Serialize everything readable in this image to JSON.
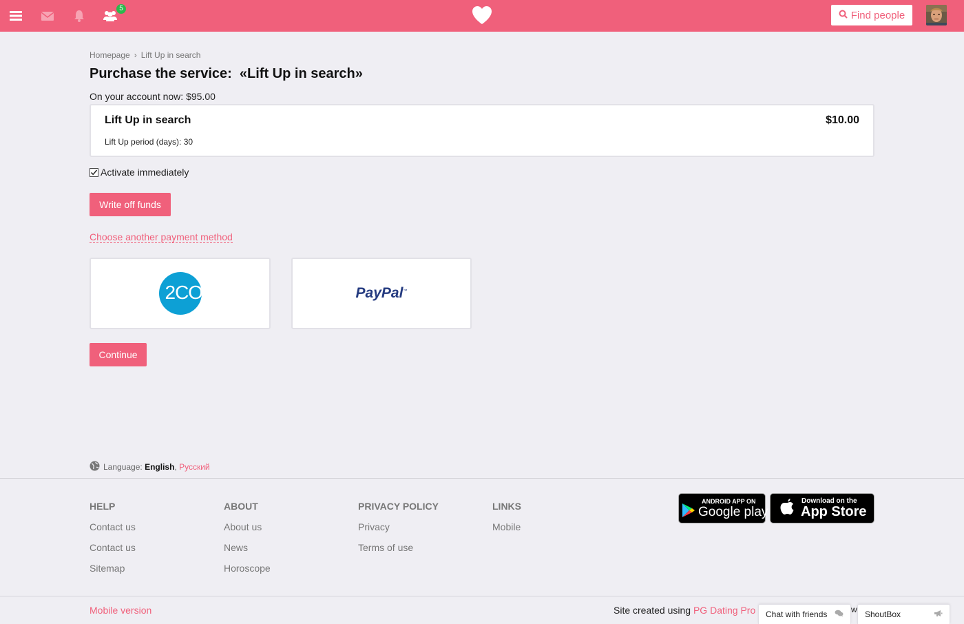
{
  "topbar": {
    "notification_count": "5",
    "find_people_label": "Find people",
    "icons": [
      "menu-icon",
      "mail-icon",
      "bell-icon",
      "friends-icon",
      "heart-icon",
      "search-icon"
    ]
  },
  "breadcrumb": {
    "home": "Homepage",
    "separator": "›",
    "current": "Lift Up in search"
  },
  "page": {
    "title": "Purchase the service:  «Lift Up in search»",
    "account_line": "On your account now: $95.00"
  },
  "service": {
    "name": "Lift Up in search",
    "price": "$10.00",
    "period": "Lift Up period (days): 30"
  },
  "activate": {
    "label": "Activate immediately",
    "checked": true
  },
  "buttons": {
    "write_off": "Write off funds",
    "choose_another": "Choose another payment method",
    "continue": "Continue"
  },
  "payment_methods": {
    "twoco": "2CO",
    "paypal": "PayPal",
    "paypal_tm": "™"
  },
  "language": {
    "label": "Language:",
    "current": "English",
    "separator": ",",
    "other": "Русский"
  },
  "footer": {
    "columns": [
      {
        "heading": "HELP",
        "links": [
          "Contact us",
          "Contact us",
          "Sitemap"
        ]
      },
      {
        "heading": "ABOUT",
        "links": [
          "About us",
          "News",
          "Horoscope"
        ]
      },
      {
        "heading": "PRIVACY POLICY",
        "links": [
          "Privacy",
          "Terms of use"
        ]
      },
      {
        "heading": "LINKS",
        "links": [
          "Mobile"
        ]
      }
    ],
    "google_play": {
      "small": "ANDROID APP ON",
      "big": "Google play"
    },
    "app_store": {
      "small": "Download on the",
      "big": "App Store"
    },
    "mobile_version": "Mobile version",
    "created_text": "Site created using",
    "created_link": "PG Dating Pro",
    "chat_tab": "Chat with friends",
    "shoutbox_tab": "ShoutBox",
    "hidden_letter": "w"
  },
  "colors": {
    "brand_pink": "#f0607b",
    "background": "#efeef3",
    "badge_green": "#2db84d",
    "twoco_blue": "#0da0d5",
    "paypal_navy": "#253b80"
  }
}
